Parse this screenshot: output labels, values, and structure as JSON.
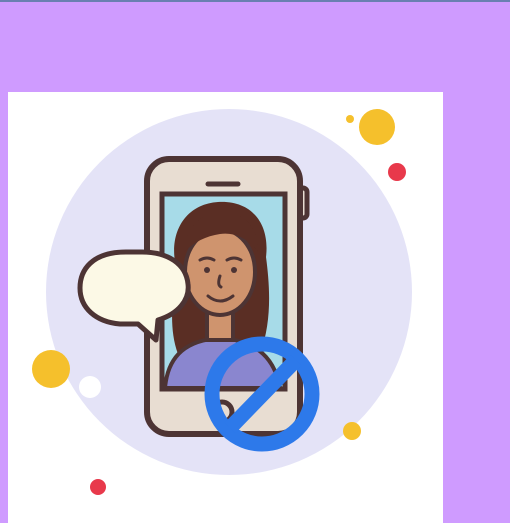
{
  "illustration": {
    "icon": "no-video-call-icon",
    "colors": {
      "page_background": "#cf9bff",
      "card_background": "#ffffff",
      "circle_background": "#e4e3f7",
      "phone_body": "#e8ddd2",
      "phone_outline": "#4d3434",
      "screen": "#a7dbe8",
      "hair": "#5a2e24",
      "skin": "#cf946e",
      "shirt": "#8a86cf",
      "speech_bubble": "#fcf9e6",
      "prohibition_sign": "#2d79ea",
      "dot_yellow": "#f5c02c",
      "dot_red": "#e8394b"
    }
  }
}
